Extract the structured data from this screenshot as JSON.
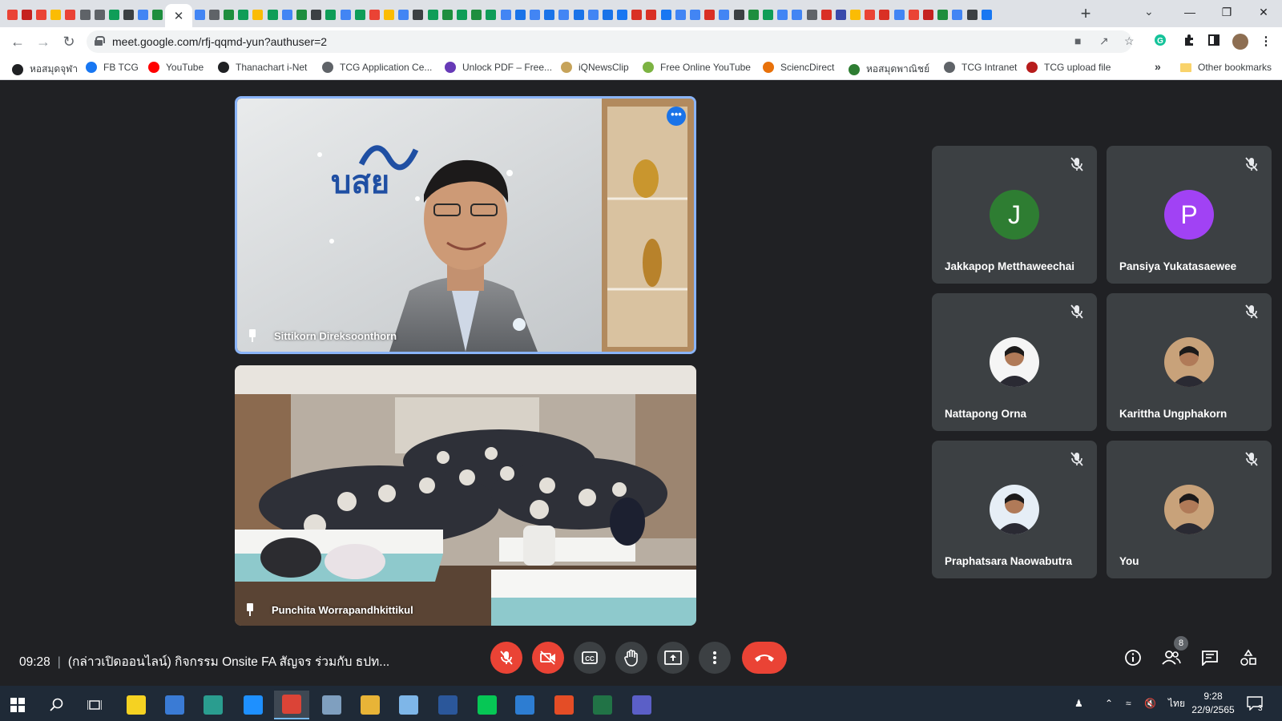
{
  "browser": {
    "active_tab_close": "✕",
    "new_tab_label": "+",
    "tab_search_label": "⌄",
    "window_controls": {
      "minimize": "—",
      "maximize": "❐",
      "close": "✕"
    },
    "pinned_tab_colors": [
      "#ea4335",
      "#c5221f",
      "#ea4335",
      "#fbbc04",
      "#ea4335",
      "#5f6368",
      "#5f6368",
      "#0f9d58",
      "#3c4043",
      "#4285f4",
      "#1e8e3e",
      "#4285f4",
      "#5f6368",
      "#1e8e3e",
      "#0f9d58",
      "#fbbc04",
      "#0f9d58",
      "#4285f4",
      "#1e8e3e",
      "#3c4043",
      "#0f9d58",
      "#4285f4",
      "#0f9d58",
      "#ea4335",
      "#fbbc04",
      "#4285f4",
      "#3c4043",
      "#0f9d58",
      "#1e8e3e",
      "#0f9d58",
      "#1e8e3e",
      "#0f9d58",
      "#4285f4",
      "#1a73e8",
      "#4285f4",
      "#1a73e8",
      "#4285f4",
      "#1a73e8",
      "#4285f4",
      "#1a73e8",
      "#1877f2",
      "#d93025",
      "#d93025",
      "#1877f2",
      "#4285f4",
      "#4285f4",
      "#d93025",
      "#4285f4",
      "#3c4043",
      "#1e8e3e",
      "#0f9d58",
      "#4285f4",
      "#4285f4",
      "#5f6368",
      "#d93025",
      "#3949ab",
      "#fbbc04",
      "#ea4335",
      "#d93025",
      "#4285f4",
      "#ea4335",
      "#c5221f",
      "#1e8e3e",
      "#4285f4",
      "#3c4043",
      "#1877f2"
    ],
    "url": "meet.google.com/rfj-qqmd-yun?authuser=2",
    "bookmarks": [
      {
        "label": "หอสมุดจุฬา",
        "color": "#202124"
      },
      {
        "label": "FB TCG",
        "color": "#1877f2"
      },
      {
        "label": "YouTube",
        "color": "#ff0000"
      },
      {
        "label": "Thanachart i-Net",
        "color": "#202124"
      },
      {
        "label": "TCG Application Ce...",
        "color": "#5f6368"
      },
      {
        "label": "Unlock PDF – Free...",
        "color": "#673ab7"
      },
      {
        "label": "iQNewsClip",
        "color": "#c6a35a"
      },
      {
        "label": "Free Online YouTube",
        "color": "#7cb342"
      },
      {
        "label": "SciencDirect",
        "color": "#e8710a"
      },
      {
        "label": "หอสมุดพาณิชย์",
        "color": "#2e7d32"
      },
      {
        "label": "TCG Intranet",
        "color": "#5f6368"
      },
      {
        "label": "TCG upload file",
        "color": "#b71c1c"
      }
    ],
    "bookmarks_more": "»",
    "other_bookmarks": "Other bookmarks"
  },
  "meeting": {
    "main_tiles": [
      {
        "name": "Sittikorn Direksoonthorn",
        "more": "•••",
        "logo_text": "บสย"
      },
      {
        "name": "Punchita Worrapandhkittikul"
      }
    ],
    "participants": [
      {
        "name": "Jakkapop Metthaweechai",
        "initial": "J",
        "avatar_color": "#2e7d32",
        "avatar_type": "initial"
      },
      {
        "name": "Pansiya Yukatasaewee",
        "initial": "P",
        "avatar_color": "#a142f4",
        "avatar_type": "initial"
      },
      {
        "name": "Nattapong Orna",
        "initial": "",
        "avatar_color": "#f5f5f5",
        "avatar_type": "photo"
      },
      {
        "name": "Karittha Ungphakorn",
        "initial": "",
        "avatar_color": "#c8a27a",
        "avatar_type": "photo"
      },
      {
        "name": "Praphatsara Naowabutra",
        "initial": "",
        "avatar_color": "#e6eef6",
        "avatar_type": "photo"
      },
      {
        "name": "You",
        "initial": "",
        "avatar_color": "#c8a27a",
        "avatar_type": "photo"
      }
    ],
    "time": "09:28",
    "separator": "|",
    "title": "(กล่าวเปิดออนไลน์) กิจกรรม Onsite FA สัญจร ร่วมกับ ธปท...",
    "people_count": "8"
  },
  "taskbar": {
    "clock_time": "9:28",
    "clock_date": "22/9/2565",
    "language": "ไทย",
    "notifications": "3"
  }
}
